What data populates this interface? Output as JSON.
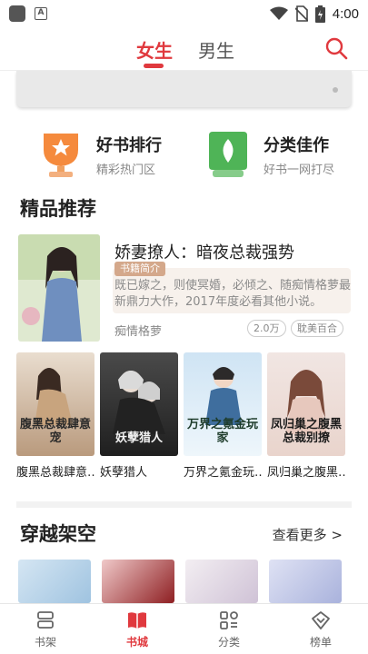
{
  "status_bar": {
    "time": "4:00",
    "left_icons": [
      "app-icon",
      "a-icon"
    ],
    "right_icons": [
      "wifi-icon",
      "no-sim-icon",
      "battery-icon"
    ]
  },
  "header": {
    "tabs": [
      {
        "label": "女生",
        "active": true
      },
      {
        "label": "男生",
        "active": false
      }
    ],
    "accent_color": "#e0393e",
    "search_icon": "search-icon"
  },
  "entries": [
    {
      "title": "好书排行",
      "subtitle": "精彩热门区",
      "icon": "trophy-icon",
      "color": "#f47f3a"
    },
    {
      "title": "分类佳作",
      "subtitle": "好书一网打尽",
      "icon": "leaf-icon",
      "color": "#4caf50"
    }
  ],
  "featured": {
    "section_title": "精品推荐",
    "book": {
      "title": "娇妻撩人：暗夜总裁强势",
      "intro_badge": "书籍简介",
      "intro": "既已嫁之，则使冥婚，必倾之、随痴情格萝最新鼎力大作，2017年度必看其他小说。",
      "author": "痴情格萝",
      "count": "2.0万",
      "tag": "耽美百合"
    }
  },
  "grid_books": [
    {
      "title": "腹黑总裁肆意…",
      "cover_text": "腹黑总裁肆意宠"
    },
    {
      "title": "妖孽猎人",
      "cover_text": "妖孽猎人"
    },
    {
      "title": "万界之氪金玩…",
      "cover_text": "万界之氪金玩家"
    },
    {
      "title": "凤归巢之腹黑…",
      "cover_text": "凤归巢之腹黑总裁别撩"
    }
  ],
  "time_travel": {
    "section_title": "穿越架空",
    "see_more": "查看更多 >"
  },
  "bottom_nav": [
    {
      "label": "书架",
      "icon": "bookshelf-icon",
      "active": false
    },
    {
      "label": "书城",
      "icon": "book-icon",
      "active": true
    },
    {
      "label": "分类",
      "icon": "category-icon",
      "active": false
    },
    {
      "label": "榜单",
      "icon": "ranking-icon",
      "active": false
    }
  ]
}
